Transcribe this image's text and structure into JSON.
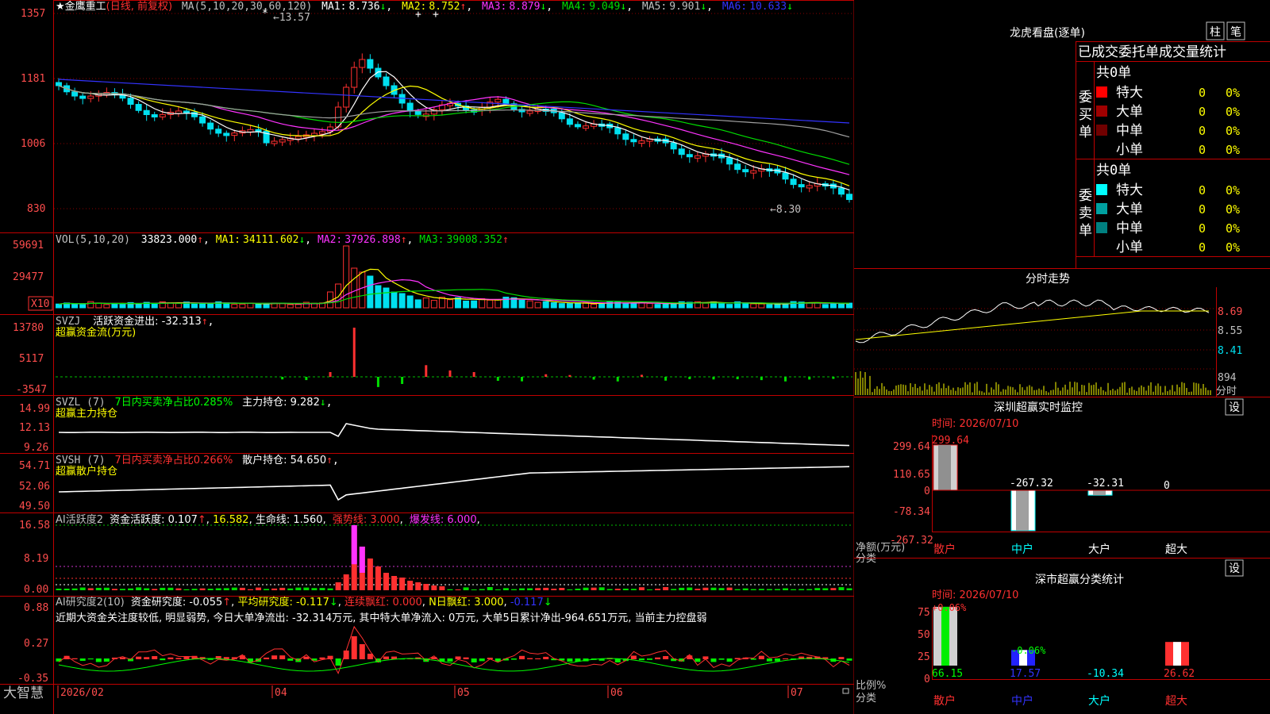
{
  "app": {
    "logo": "大智慧"
  },
  "colors": {
    "up": "#ff3030",
    "down": "#00e0f0",
    "grid": "#b00000",
    "frame": "#c00000",
    "ma1": "#ffffff",
    "ma2": "#ffff00",
    "ma3": "#ff33ff",
    "ma4": "#00dd00",
    "ma5": "#a0a0a0",
    "ma6": "#3333ff"
  },
  "price_panel": {
    "stock_name": "金鹰重工",
    "period": "(日线, 前复权)",
    "ma_label": "MA(5,10,20,30,60,120)",
    "ma": [
      {
        "name": "MA1:",
        "value": "8.736",
        "arrow": "↓"
      },
      {
        "name": "MA2:",
        "value": "8.752",
        "arrow": "↑"
      },
      {
        "name": "MA3:",
        "value": "8.879",
        "arrow": "↓"
      },
      {
        "name": "MA4:",
        "value": "9.049",
        "arrow": "↓"
      },
      {
        "name": "MA5:",
        "value": "9.901",
        "arrow": "↓"
      },
      {
        "name": "MA6:",
        "value": "10.633",
        "arrow": "↓"
      }
    ],
    "y_ticks": [
      "1357",
      "1181",
      "1006",
      "830"
    ],
    "high_label": "←13.57",
    "low_label": "←8.30",
    "star_marks": [
      "*",
      "+",
      "+"
    ]
  },
  "vol_panel": {
    "label": "VOL(5,10,20)",
    "value": "33823.000",
    "ma": [
      {
        "name": "MA1:",
        "value": "34111.602",
        "arrow": "↓"
      },
      {
        "name": "MA2:",
        "value": "37926.898",
        "arrow": "↑"
      },
      {
        "name": "MA3:",
        "value": "39008.352",
        "arrow": "↑"
      }
    ],
    "y_ticks": [
      "59691",
      "29477"
    ],
    "unit": "X10"
  },
  "svzj_panel": {
    "label": "SVZJ",
    "text": "活跃资金进出: -32.313",
    "arrow": "↑",
    "title": "超赢资金流(万元)",
    "y_ticks": [
      "13780",
      "5117",
      "-3547"
    ]
  },
  "svzl_panel": {
    "label": "SVZL (7)",
    "ratio_text": "7日内买卖净占比0.285%",
    "hold_text": "主力持仓: 9.282",
    "arrow": "↓",
    "title": "超赢主力持仓",
    "y_ticks": [
      "14.99",
      "12.13",
      "9.26"
    ]
  },
  "svsh_panel": {
    "label": "SVSH (7)",
    "ratio_text": "7日内买卖净占比0.266%",
    "hold_text": "散户持仓: 54.650",
    "arrow": "↑",
    "title": "超赢散户持仓",
    "y_ticks": [
      "54.71",
      "52.06",
      "49.50"
    ]
  },
  "ai_active_panel": {
    "label": "AI活跃度2",
    "items": [
      {
        "text": "资金活跃度: 0.107",
        "arrow": "↑"
      },
      {
        "text": "16.582",
        "arrow": ""
      },
      {
        "text": "生命线: 1.560",
        "arrow": ""
      },
      {
        "text": "强势线: 3.000",
        "arrow": ""
      },
      {
        "text": "爆发线: 6.000",
        "arrow": ""
      }
    ],
    "y_ticks": [
      "16.58",
      "8.19",
      "0.00"
    ]
  },
  "ai_research_panel": {
    "label": "AI研究度2(10)",
    "items": [
      {
        "text": "资金研究度: -0.055",
        "arrow": "↑"
      },
      {
        "text": "平均研究度: -0.117",
        "arrow": "↓"
      },
      {
        "text": "连续飘红: 0.000",
        "arrow": ""
      },
      {
        "text": "N日飘红: 3.000",
        "arrow": ""
      },
      {
        "text": "-0.117",
        "arrow": "↓"
      }
    ],
    "comment": "近期大资金关注度较低, 明显弱势, 今日大单净流出: -32.314万元, 其中特大单净流入: 0万元, 大单5日累计净出-964.651万元, 当前主力控盘弱",
    "y_ticks": [
      "0.88",
      "0.27",
      "-0.35"
    ]
  },
  "x_axis": {
    "labels": [
      "2026/02",
      "04",
      "05",
      "06",
      "07"
    ]
  },
  "dragon_tiger": {
    "title": "龙虎看盘(逐单)",
    "btn_bar": "柱",
    "btn_stroke": "笔",
    "subtitle": "已成交委托单成交量统计",
    "buy": {
      "label": "委买单",
      "count": "共0单",
      "rows": [
        {
          "name": "特大",
          "count": "0",
          "pct": "0%",
          "color": "#ff0000"
        },
        {
          "name": "大单",
          "count": "0",
          "pct": "0%",
          "color": "#a00000"
        },
        {
          "name": "中单",
          "count": "0",
          "pct": "0%",
          "color": "#700000"
        },
        {
          "name": "小单",
          "count": "0",
          "pct": "0%",
          "color": "#000000"
        }
      ]
    },
    "sell": {
      "label": "委卖单",
      "count": "共0单",
      "rows": [
        {
          "name": "特大",
          "count": "0",
          "pct": "0%",
          "color": "#00ffff"
        },
        {
          "name": "大单",
          "count": "0",
          "pct": "0%",
          "color": "#00a0a0"
        },
        {
          "name": "中单",
          "count": "0",
          "pct": "0%",
          "color": "#008080"
        },
        {
          "name": "小单",
          "count": "0",
          "pct": "0%",
          "color": "#000000"
        }
      ]
    }
  },
  "intraday": {
    "title": "分时走势",
    "y_ticks": [
      "8.69",
      "8.55",
      "8.41"
    ],
    "vol_tick": "894",
    "fenshi_label": "分时"
  },
  "realtime_monitor": {
    "title": "深圳超赢实时监控",
    "set_btn": "设",
    "time": "时间: 2026/07/10",
    "y_ticks": [
      "299.64",
      "110.65",
      "0",
      "-78.34",
      "-267.32"
    ],
    "y_unit": "净额(万元)",
    "x_unit": "分类",
    "categories": [
      "散户",
      "中户",
      "大户",
      "超大"
    ],
    "values": [
      "299.64",
      "-267.32",
      "-32.31",
      "0"
    ]
  },
  "class_stats": {
    "title": "深市超赢分类统计",
    "set_btn": "设",
    "time": "时间: 2026/07/10",
    "y_ticks": [
      "75",
      "50",
      "25",
      "0"
    ],
    "y_unit": "比例%",
    "x_unit": "分类",
    "categories": [
      "散户",
      "中户",
      "大户",
      "超大"
    ],
    "top_labels": [
      "+0.06%",
      "-0.06%"
    ],
    "values": [
      "66.15",
      "17.57",
      "-10.34",
      "26.62"
    ]
  },
  "chart_data": [
    {
      "type": "bar",
      "title": "深圳超赢实时监控",
      "categories": [
        "散户",
        "中户",
        "大户",
        "超大"
      ],
      "values": [
        299.64,
        -267.32,
        -32.31,
        0
      ],
      "ylabel": "净额(万元)",
      "xlabel": "分类",
      "ylim": [
        -267.32,
        299.64
      ]
    },
    {
      "type": "bar",
      "title": "深市超赢分类统计",
      "categories": [
        "散户",
        "中户",
        "大户",
        "超大"
      ],
      "values": [
        66.15,
        17.57,
        -10.34,
        26.62
      ],
      "ylabel": "比例%",
      "xlabel": "分类",
      "ylim": [
        0,
        75
      ]
    }
  ]
}
